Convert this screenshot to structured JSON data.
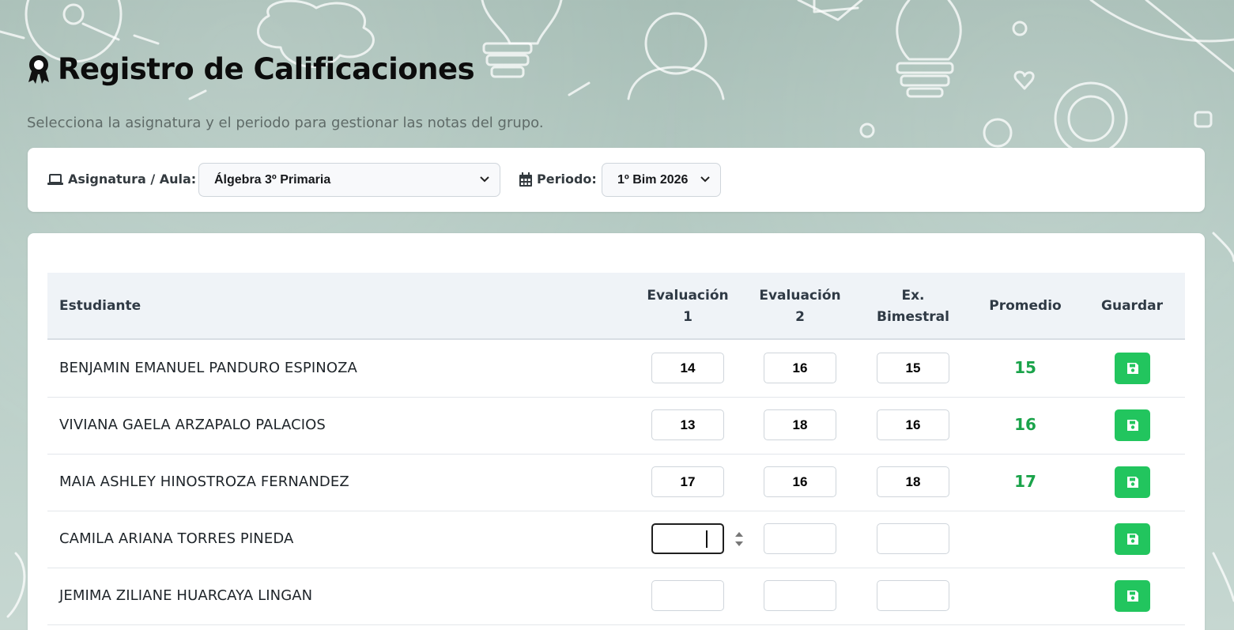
{
  "header": {
    "title": "Registro de Calificaciones",
    "subtitle": "Selecciona la asignatura y el periodo para gestionar las notas del grupo."
  },
  "filters": {
    "subject_label": "Asignatura / Aula:",
    "subject_value": "Álgebra 3º Primaria",
    "period_label": "Periodo:",
    "period_value": "1º Bim 2026"
  },
  "table": {
    "columns": {
      "student": "Estudiante",
      "eval1_a": "Evaluación",
      "eval1_b": "1",
      "eval2_a": "Evaluación",
      "eval2_b": "2",
      "exam_a": "Ex.",
      "exam_b": "Bimestral",
      "average": "Promedio",
      "save": "Guardar"
    },
    "rows": [
      {
        "name": "BENJAMIN EMANUEL PANDURO ESPINOZA",
        "eval1": "14",
        "eval2": "16",
        "exam": "15",
        "average": "15"
      },
      {
        "name": "VIVIANA GAELA ARZAPALO PALACIOS",
        "eval1": "13",
        "eval2": "18",
        "exam": "16",
        "average": "16"
      },
      {
        "name": "MAIA ASHLEY HINOSTROZA FERNANDEZ",
        "eval1": "17",
        "eval2": "16",
        "exam": "18",
        "average": "17"
      },
      {
        "name": "CAMILA ARIANA TORRES PINEDA",
        "eval1": "",
        "eval2": "",
        "exam": "",
        "average": ""
      },
      {
        "name": "JEMIMA ZILIANE HUARCAYA LINGAN",
        "eval1": "",
        "eval2": "",
        "exam": "",
        "average": ""
      }
    ]
  },
  "colors": {
    "save_button": "#22c55e",
    "average_text": "#1aa34a",
    "background": "#b2c8c0"
  },
  "icons": {
    "title": "award-icon",
    "subject": "laptop-icon",
    "period": "calendar-icon",
    "save": "floppy-disk-icon"
  }
}
